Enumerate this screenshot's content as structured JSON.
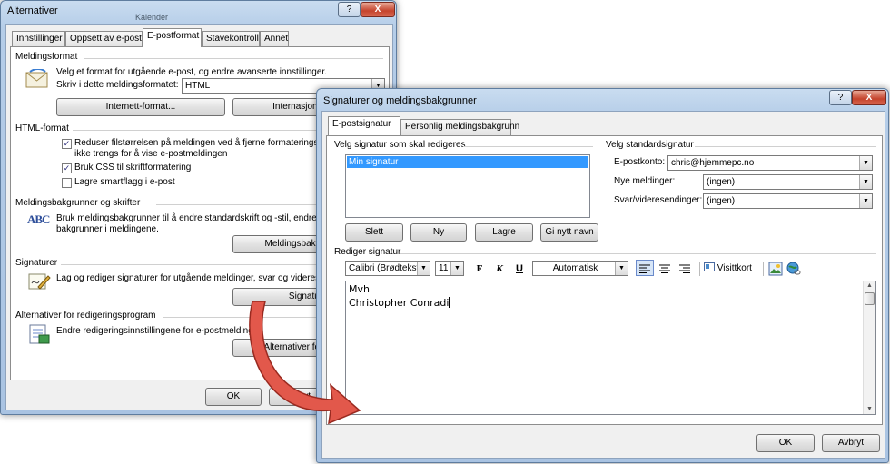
{
  "bg_window": {
    "title": "Alternativer",
    "help": "?",
    "close": "X",
    "behind_tab": "Kalender",
    "tabs": [
      "Innstillinger",
      "Oppsett av e-post",
      "E-postformat",
      "Stavekontroll",
      "Annet"
    ],
    "meldingsformat": {
      "title": "Meldingsformat",
      "desc": "Velg et format for utgående e-post, og endre avanserte innstillinger.",
      "compose_label": "Skriv i dette meldingsformatet:",
      "compose_value": "HTML",
      "internet_btn": "Internett-format...",
      "intl_btn": "Internasjonale alte"
    },
    "html_format": {
      "title": "HTML-format",
      "reduce_label_1": "Reduser filstørrelsen på meldingen ved å fjerne formateringsinform",
      "reduce_label_2": "ikke trengs for å vise e-postmeldingen",
      "css_label": "Bruk CSS til skriftformatering",
      "smarttag_label": "Lagre smartflagg i e-post",
      "check": "✓"
    },
    "backgrounds": {
      "title": "Meldingsbakgrunner og skrifter",
      "desc_1": "Bruk meldingsbakgrunner til å endre standardskrift og -stil, endre farge",
      "desc_2": "bakgrunner i meldingene.",
      "btn": "Meldingsbakgrunner o",
      "icon_text": "ABC"
    },
    "signatures": {
      "title": "Signaturer",
      "desc": "Lag og rediger signaturer for utgående meldinger, svar og videresendin",
      "btn": "Signaturer"
    },
    "editor": {
      "title": "Alternativer for redigeringsprogram",
      "desc": "Endre redigeringsinnstillingene for e-postmeldinger.",
      "btn": "Alternativer for redigeri"
    },
    "ok": "OK",
    "cancel": "Avbryt"
  },
  "fg_window": {
    "title": "Signaturer og meldingsbakgrunner",
    "help": "?",
    "close": "X",
    "tabs": [
      "E-postsignatur",
      "Personlig meldingsbakgrunn"
    ],
    "select_sig_label": "Velg signatur som skal redigeres",
    "sig_items": [
      "Min signatur"
    ],
    "btn_delete": "Slett",
    "btn_new": "Ny",
    "btn_save": "Lagre",
    "btn_rename": "Gi nytt navn",
    "default_sig_label": "Velg standardsignatur",
    "account_label": "E-postkonto:",
    "account_value": "chris@hjemmepc.no",
    "new_msg_label": "Nye meldinger:",
    "new_msg_value": "(ingen)",
    "reply_label": "Svar/videresendinger:",
    "reply_value": "(ingen)",
    "edit_sig_label": "Rediger signatur",
    "font_value": "Calibri (Brødtekst)",
    "size_value": "11",
    "bold": "F",
    "italic": "K",
    "underline": "U",
    "color_value": "Automatisk",
    "business_card": "Visittkort",
    "sig_lines": [
      "Mvh",
      "Christopher Conradi"
    ],
    "ok": "OK",
    "cancel": "Avbryt"
  },
  "colors": {
    "arrow": "#e2584b",
    "selection": "#3399ff"
  }
}
